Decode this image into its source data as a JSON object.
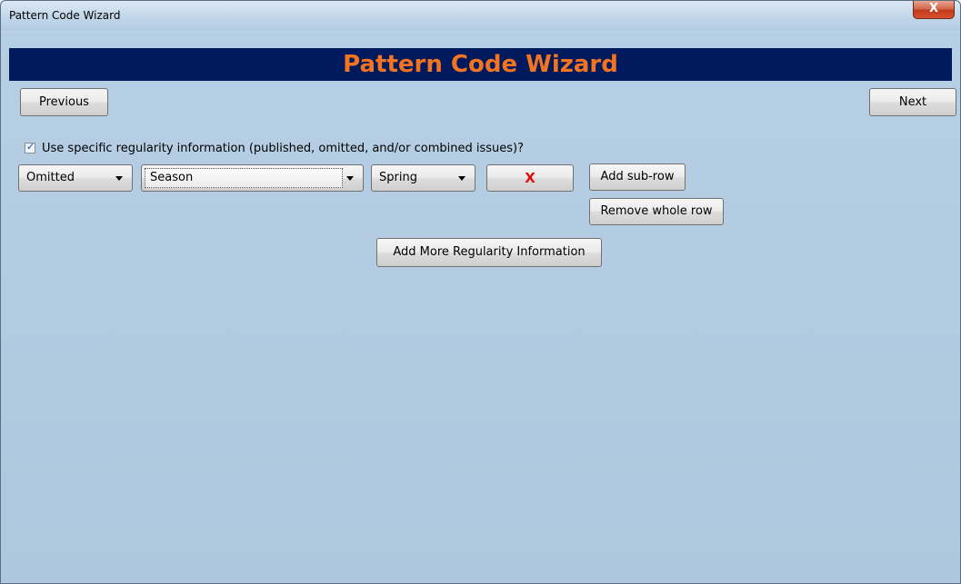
{
  "window": {
    "title": "Pattern Code Wizard",
    "close_label": "X"
  },
  "header": {
    "title": "Pattern Code Wizard"
  },
  "nav": {
    "previous_label": "Previous",
    "next_label": "Next"
  },
  "regularity": {
    "checkbox_label": "Use specific regularity information (published, omitted, and/or combined issues)?",
    "checked": true,
    "row": {
      "type_value": "Omitted",
      "unit_value": "Season",
      "season_value": "Spring",
      "remove_sub_label": "X",
      "add_subrow_label": "Add sub-row",
      "remove_row_label": "Remove whole row"
    },
    "add_more_label": "Add More Regularity Information"
  },
  "colors": {
    "header_bg": "#011a5e",
    "header_text": "#f27320",
    "remove_x": "#e01010"
  }
}
